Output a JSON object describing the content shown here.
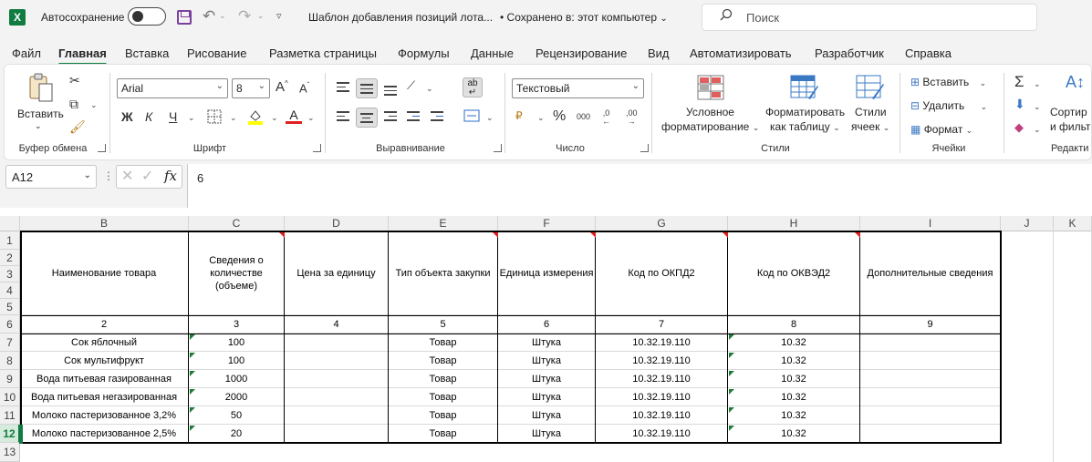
{
  "titlebar": {
    "app_logo": "X",
    "autosave_label": "Автосохранение",
    "doc_title": "Шаблон добавления позиций лота...",
    "saved_status": "•  Сохранено в: этот компьютер",
    "search_placeholder": "Поиск"
  },
  "menu": {
    "tabs": [
      "Файл",
      "Главная",
      "Вставка",
      "Рисование",
      "Разметка страницы",
      "Формулы",
      "Данные",
      "Рецензирование",
      "Вид",
      "Автоматизировать",
      "Разработчик",
      "Справка"
    ],
    "active": "Главная"
  },
  "ribbon": {
    "clipboard": {
      "paste_label": "Вставить",
      "group_label": "Буфер обмена"
    },
    "font": {
      "font_name": "Arial",
      "font_size": "8",
      "bold": "Ж",
      "italic": "К",
      "underline": "Ч",
      "grow": "A",
      "shrink": "A",
      "group_label": "Шрифт"
    },
    "alignment": {
      "wrap_label": "ab",
      "group_label": "Выравнивание"
    },
    "number": {
      "format": "Текстовый",
      "percent": "%",
      "thousands": "000",
      "inc_decimal": ",0",
      "dec_decimal": ",00",
      "group_label": "Число"
    },
    "styles": {
      "conditional_l1": "Условное",
      "conditional_l2": "форматирование",
      "format_table_l1": "Форматировать",
      "format_table_l2": "как таблицу",
      "cell_styles_l1": "Стили",
      "cell_styles_l2": "ячеек",
      "group_label": "Стили"
    },
    "cells": {
      "insert": "Вставить",
      "delete": "Удалить",
      "format": "Формат",
      "group_label": "Ячейки"
    },
    "editing": {
      "sort_l1": "Сортир",
      "sort_l2": "и фильт",
      "group_label": "Редакти"
    }
  },
  "formula_bar": {
    "name_box": "A12",
    "fx": "fx",
    "value": "6"
  },
  "columns": [
    "B",
    "C",
    "D",
    "E",
    "F",
    "G",
    "H",
    "I",
    "J",
    "K"
  ],
  "rows": [
    "1",
    "2",
    "3",
    "4",
    "5",
    "6",
    "7",
    "8",
    "9",
    "10",
    "11",
    "12",
    "13"
  ],
  "table": {
    "headers": [
      "Наименование товара",
      "Сведения о количестве (объеме)",
      "Цена за единицу",
      "Тип объекта закупки",
      "Единица измерения",
      "Код по ОКПД2",
      "Код по ОКВЭД2",
      "Дополнительные сведения"
    ],
    "numbers": [
      "2",
      "3",
      "4",
      "5",
      "6",
      "7",
      "8",
      "9"
    ],
    "data": [
      [
        "Сок яблочный",
        "100",
        "",
        "Товар",
        "Штука",
        "10.32.19.110",
        "10.32",
        ""
      ],
      [
        "Сок мультифрукт",
        "100",
        "",
        "Товар",
        "Штука",
        "10.32.19.110",
        "10.32",
        ""
      ],
      [
        "Вода питьевая газированная",
        "1000",
        "",
        "Товар",
        "Штука",
        "10.32.19.110",
        "10.32",
        ""
      ],
      [
        "Вода питьевая негазированная",
        "2000",
        "",
        "Товар",
        "Штука",
        "10.32.19.110",
        "10.32",
        ""
      ],
      [
        "Молоко пастеризованное 3,2%",
        "50",
        "",
        "Товар",
        "Штука",
        "10.32.19.110",
        "10.32",
        ""
      ],
      [
        "Молоко пастеризованное 2,5%",
        "20",
        "",
        "Товар",
        "Штука",
        "10.32.19.110",
        "10.32",
        ""
      ]
    ]
  },
  "colors": {
    "accent": "#107c41",
    "comment_marker": "#e02020",
    "error_marker": "#1f7a3a"
  }
}
